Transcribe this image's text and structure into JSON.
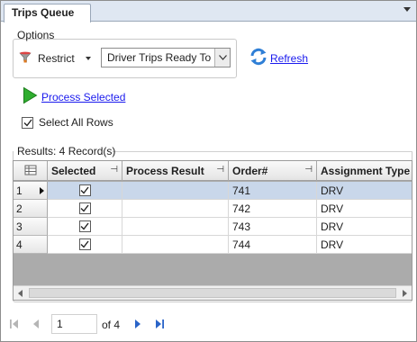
{
  "tab": {
    "label": "Trips Queue"
  },
  "options": {
    "group_label": "Options",
    "restrict_label": "Restrict",
    "filter_value": "Driver Trips Ready To S",
    "refresh_label": "Refresh"
  },
  "actions": {
    "process_selected_label": "Process Selected",
    "select_all_label": "Select All Rows",
    "select_all_checked": true
  },
  "results": {
    "label": "Results: 4 Record(s)",
    "columns": [
      "Selected",
      "Process Result",
      "Order#",
      "Assignment Type"
    ],
    "rows": [
      {
        "num": "1",
        "selected": true,
        "process_result": "",
        "order": "741",
        "type": "DRV"
      },
      {
        "num": "2",
        "selected": true,
        "process_result": "",
        "order": "742",
        "type": "DRV"
      },
      {
        "num": "3",
        "selected": true,
        "process_result": "",
        "order": "743",
        "type": "DRV"
      },
      {
        "num": "4",
        "selected": true,
        "process_result": "",
        "order": "744",
        "type": "DRV"
      }
    ],
    "selected_row": 0
  },
  "pager": {
    "current_page": "1",
    "of_label": "of 4"
  },
  "colors": {
    "link": "#1a1aee",
    "selected_row": "#c9d7ea",
    "accent_green": "#2fae2f",
    "refresh_blue": "#2f7fd6"
  }
}
